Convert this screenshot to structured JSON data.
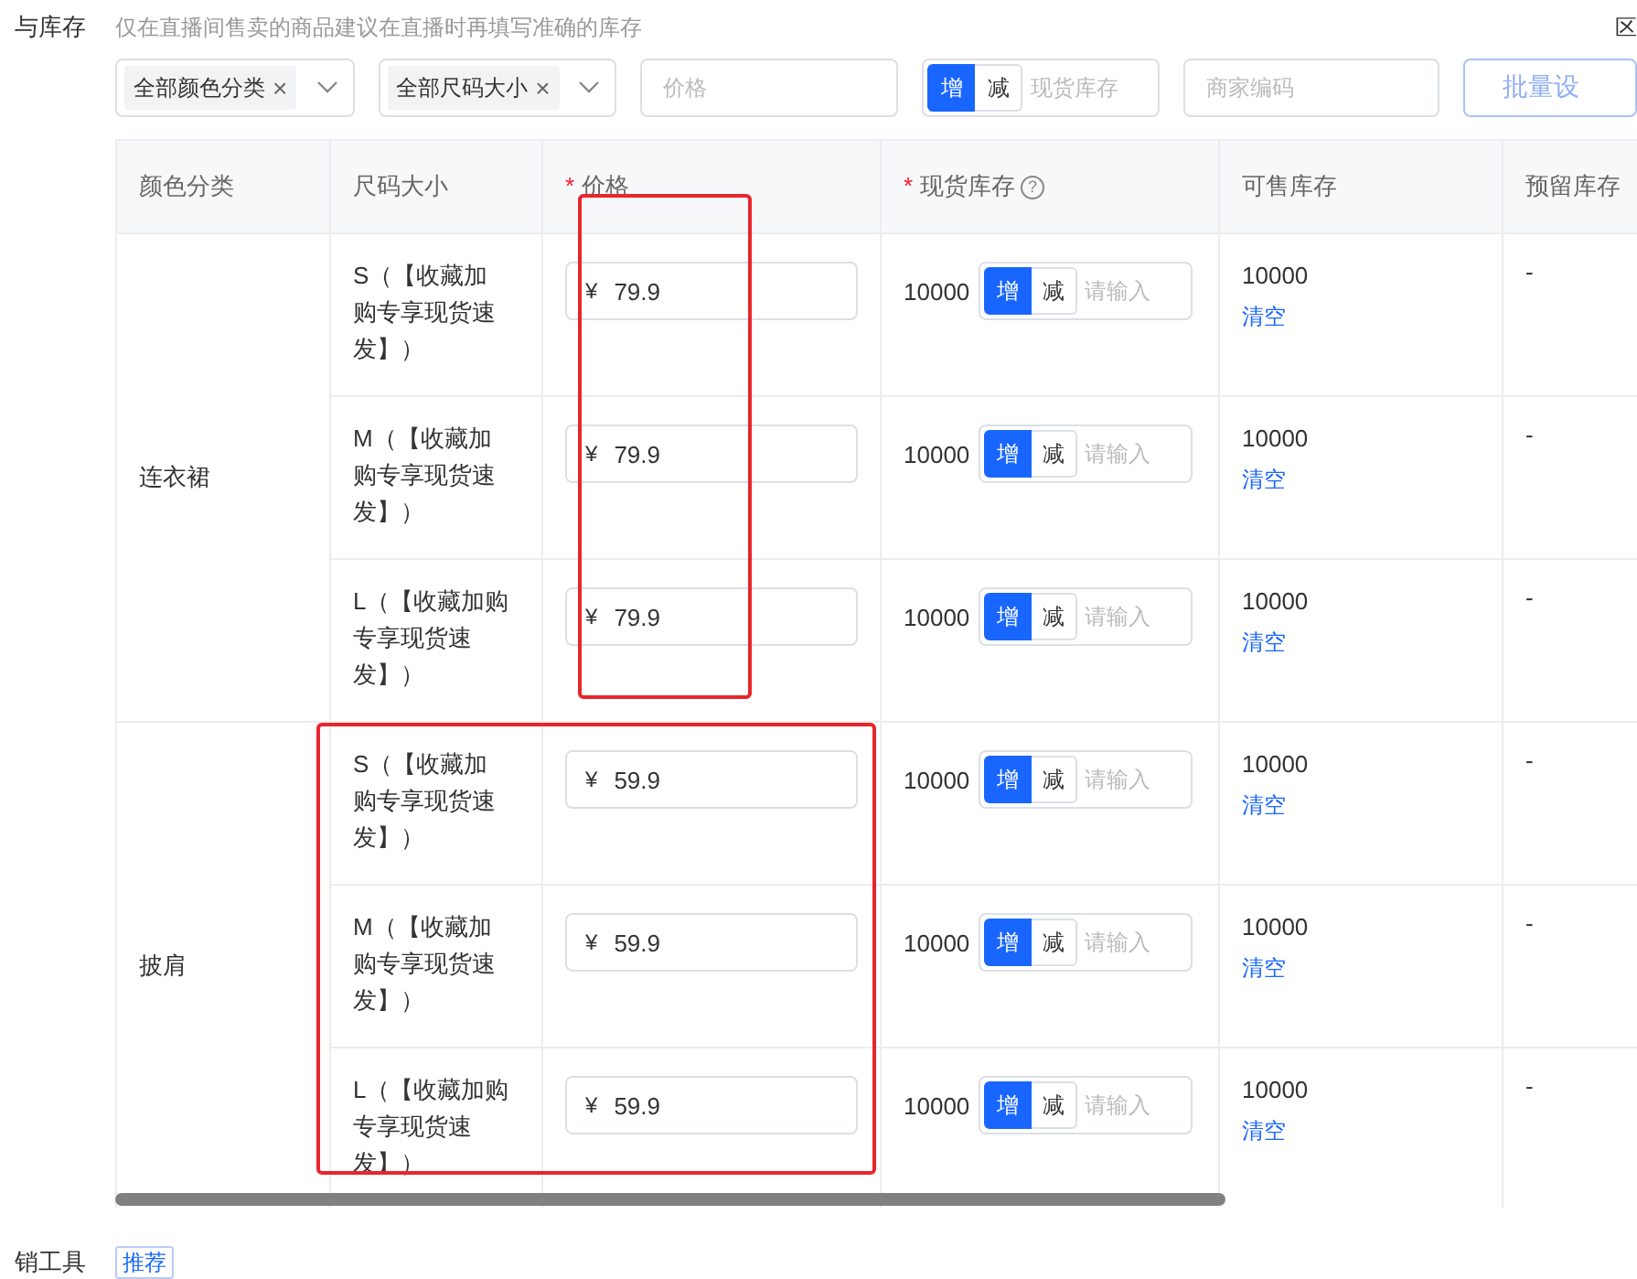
{
  "section_label": "与库存",
  "hint": "仅在直播间售卖的商品建议在直播时再填写准确的库存",
  "corner_label": "区",
  "filters": {
    "selects": [
      {
        "tag": "全部颜色分类",
        "remove": "×"
      },
      {
        "tag": "全部尺码大小",
        "remove": "×"
      }
    ],
    "price": {
      "placeholder": "价格"
    },
    "stock": {
      "mode_options": [
        {
          "label": "增",
          "selected": true
        },
        {
          "label": "减",
          "selected": false
        }
      ],
      "placeholder": "现货库存"
    },
    "sku_code": {
      "placeholder": "商家编码"
    },
    "batch_button": "批量设"
  },
  "table": {
    "columns": [
      {
        "label": "颜色分类",
        "required": false
      },
      {
        "label": "尺码大小",
        "required": false
      },
      {
        "label": "价格",
        "required": true,
        "required_mark": "*"
      },
      {
        "label": "现货库存",
        "required": true,
        "required_mark": "*",
        "help": "?"
      },
      {
        "label": "可售库存",
        "required": false
      },
      {
        "label": "预留库存",
        "required": false
      }
    ],
    "groups": [
      {
        "color_name": "连衣裙",
        "rows": [
          {
            "size": "S（【收藏加购专享现货速发】）",
            "currency": "¥",
            "price": "79.9",
            "stock": "10000",
            "mode_options": [
              {
                "label": "增",
                "selected": true
              },
              {
                "label": "减",
                "selected": false
              }
            ],
            "stock_placeholder": "请输入",
            "available": "10000",
            "clear_link": "清空",
            "reserved": "-"
          },
          {
            "size": "M（【收藏加购专享现货速发】）",
            "currency": "¥",
            "price": "79.9",
            "stock": "10000",
            "mode_options": [
              {
                "label": "增",
                "selected": true
              },
              {
                "label": "减",
                "selected": false
              }
            ],
            "stock_placeholder": "请输入",
            "available": "10000",
            "clear_link": "清空",
            "reserved": "-"
          },
          {
            "size": "L（【收藏加购专享现货速发】）",
            "currency": "¥",
            "price": "79.9",
            "stock": "10000",
            "mode_options": [
              {
                "label": "增",
                "selected": true
              },
              {
                "label": "减",
                "selected": false
              }
            ],
            "stock_placeholder": "请输入",
            "available": "10000",
            "clear_link": "清空",
            "reserved": "-"
          }
        ]
      },
      {
        "color_name": "披肩",
        "rows": [
          {
            "size": "S（【收藏加购专享现货速发】）",
            "currency": "¥",
            "price": "59.9",
            "stock": "10000",
            "mode_options": [
              {
                "label": "增",
                "selected": true
              },
              {
                "label": "减",
                "selected": false
              }
            ],
            "stock_placeholder": "请输入",
            "available": "10000",
            "clear_link": "清空",
            "reserved": "-"
          },
          {
            "size": "M（【收藏加购专享现货速发】）",
            "currency": "¥",
            "price": "59.9",
            "stock": "10000",
            "mode_options": [
              {
                "label": "增",
                "selected": true
              },
              {
                "label": "减",
                "selected": false
              }
            ],
            "stock_placeholder": "请输入",
            "available": "10000",
            "clear_link": "清空",
            "reserved": "-"
          },
          {
            "size": "L（【收藏加购专享现货速发】）",
            "currency": "¥",
            "price": "59.9",
            "stock": "10000",
            "mode_options": [
              {
                "label": "增",
                "selected": true
              },
              {
                "label": "减",
                "selected": false
              }
            ],
            "stock_placeholder": "请输入",
            "available": "10000",
            "clear_link": "清空",
            "reserved": "-"
          }
        ]
      }
    ]
  },
  "footer": {
    "label": "销工具",
    "tag": "推荐"
  }
}
